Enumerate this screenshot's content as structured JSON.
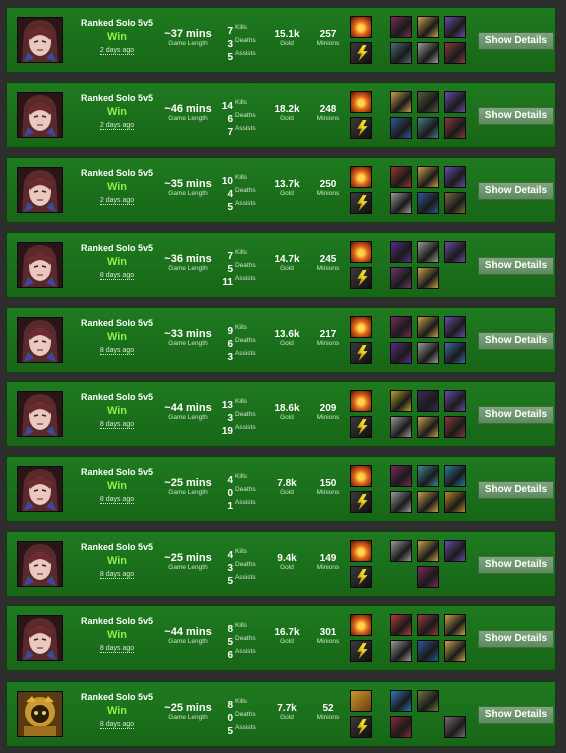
{
  "labels": {
    "game_length": "Game Length",
    "kills": "Kills",
    "deaths": "Deaths",
    "assists": "Assists",
    "gold": "Gold",
    "minions": "Minions",
    "show_details": "Show Details"
  },
  "colors": {
    "row_background": "#1f7a1f",
    "win_text": "#8cf04a",
    "page_background": "#2e2e2e"
  },
  "matches": [
    {
      "champion": "champion-portrait-icon",
      "mode": "Ranked Solo 5v5",
      "result": "Win",
      "ago": "2 days ago",
      "length": "~37 mins",
      "kills": "7",
      "deaths": "3",
      "assists": "5",
      "gold": "15.1k",
      "minions": "257",
      "spells": [
        "ignite-icon",
        "ghost-bolt-icon"
      ],
      "items": [
        [
          "#7a2a5a",
          "#c9a04a",
          "#6a4aa8"
        ],
        [
          "#4a6a7a",
          "#9a9a9a",
          "#8a3a3a"
        ]
      ]
    },
    {
      "champion": "champion-portrait-icon",
      "mode": "Ranked Solo 5v5",
      "result": "Win",
      "ago": "2 days ago",
      "length": "~46 mins",
      "kills": "14",
      "deaths": "6",
      "assists": "7",
      "gold": "18.2k",
      "minions": "248",
      "spells": [
        "ignite-icon",
        "ghost-bolt-icon"
      ],
      "items": [
        [
          "#c9a04a",
          "#5a5a3a",
          "#6a4aa8"
        ],
        [
          "#2a5a9a",
          "#4a7a8a",
          "#8a3a3a"
        ]
      ]
    },
    {
      "champion": "champion-portrait-icon",
      "mode": "Ranked Solo 5v5",
      "result": "Win",
      "ago": "2 days ago",
      "length": "~35 mins",
      "kills": "10",
      "deaths": "4",
      "assists": "5",
      "gold": "13.7k",
      "minions": "250",
      "spells": [
        "ignite-icon",
        "ghost-bolt-icon"
      ],
      "items": [
        [
          "#9a3a2a",
          "#c9a04a",
          "#6a4aa8"
        ],
        [
          "#9a9a9a",
          "#2a5a9a",
          "#7a6a3a"
        ]
      ]
    },
    {
      "champion": "champion-portrait-icon",
      "mode": "Ranked Solo 5v5",
      "result": "Win",
      "ago": "8 days ago",
      "length": "~36 mins",
      "kills": "7",
      "deaths": "5",
      "assists": "11",
      "gold": "14.7k",
      "minions": "245",
      "spells": [
        "ignite-icon",
        "ghost-bolt-icon"
      ],
      "items": [
        [
          "#5a2a8a",
          "#9a9a9a",
          "#6a4aa8"
        ],
        [
          "#6a3a6a",
          "#c9a04a",
          null
        ]
      ]
    },
    {
      "champion": "champion-portrait-icon",
      "mode": "Ranked Solo 5v5",
      "result": "Win",
      "ago": "8 days ago",
      "length": "~33 mins",
      "kills": "9",
      "deaths": "6",
      "assists": "3",
      "gold": "13.6k",
      "minions": "217",
      "spells": [
        "ignite-icon",
        "ghost-bolt-icon"
      ],
      "items": [
        [
          "#7a2a5a",
          "#c9a04a",
          "#6a4aa8"
        ],
        [
          "#5a2a8a",
          "#9a9a9a",
          "#3a6aa8"
        ]
      ]
    },
    {
      "champion": "champion-portrait-icon",
      "mode": "Ranked Solo 5v5",
      "result": "Win",
      "ago": "8 days ago",
      "length": "~44 mins",
      "kills": "13",
      "deaths": "3",
      "assists": "19",
      "gold": "18.6k",
      "minions": "209",
      "spells": [
        "ignite-icon",
        "ghost-bolt-icon"
      ],
      "items": [
        [
          "#b8a22a",
          "#3a2a5a",
          "#6a4aa8"
        ],
        [
          "#9a9a9a",
          "#c9a04a",
          "#8a3a3a"
        ]
      ]
    },
    {
      "champion": "champion-portrait-icon",
      "mode": "Ranked Solo 5v5",
      "result": "Win",
      "ago": "8 days ago",
      "length": "~25 mins",
      "kills": "4",
      "deaths": "0",
      "assists": "1",
      "gold": "7.8k",
      "minions": "150",
      "spells": [
        "ignite-icon",
        "ghost-bolt-icon"
      ],
      "items": [
        [
          "#7a2a5a",
          "#3a8a9a",
          "#2a7a9a"
        ],
        [
          "#9a9a9a",
          "#c9a04a",
          "#b8862a"
        ]
      ]
    },
    {
      "champion": "champion-portrait-icon",
      "mode": "Ranked Solo 5v5",
      "result": "Win",
      "ago": "8 days ago",
      "length": "~25 mins",
      "kills": "4",
      "deaths": "3",
      "assists": "5",
      "gold": "9.4k",
      "minions": "149",
      "spells": [
        "ignite-icon",
        "ghost-bolt-icon"
      ],
      "items": [
        [
          "#9a9a9a",
          "#c9a04a",
          "#6a4aa8"
        ],
        [
          null,
          "#7a2a5a",
          null
        ]
      ]
    },
    {
      "champion": "champion-portrait-icon",
      "mode": "Ranked Solo 5v5",
      "result": "Win",
      "ago": "8 days ago",
      "length": "~44 mins",
      "kills": "8",
      "deaths": "5",
      "assists": "6",
      "gold": "16.7k",
      "minions": "301",
      "spells": [
        "ignite-icon",
        "ghost-bolt-icon"
      ],
      "items": [
        [
          "#b83a3a",
          "#9a3a3a",
          "#c9a04a"
        ],
        [
          "#9a9a9a",
          "#2a5a9a",
          "#c9a04a"
        ]
      ]
    },
    {
      "champion": "champion-portrait-gold-icon",
      "mode": "Ranked Solo 5v5",
      "result": "Win",
      "ago": "8 days ago",
      "length": "~25 mins",
      "kills": "8",
      "deaths": "0",
      "assists": "5",
      "gold": "7.7k",
      "minions": "52",
      "spells": [
        "flash-icon",
        "ghost-bolt-icon"
      ],
      "items": [
        [
          "#2a7ab8",
          "#6a7a3a",
          null
        ],
        [
          "#8a2a3a",
          null,
          "#7a6a6a"
        ]
      ]
    }
  ]
}
